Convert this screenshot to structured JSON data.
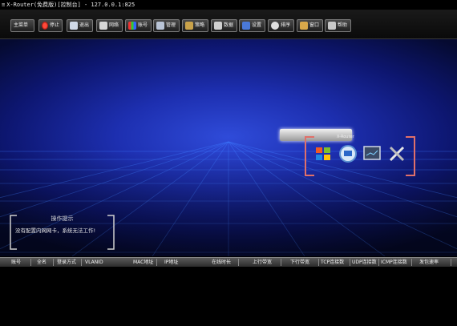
{
  "window": {
    "title": "X-Router(免费版)[控制台] - 127.0.0.1:825"
  },
  "toolbar": {
    "buttons": [
      {
        "label": "主菜单",
        "icon": "menu-icon"
      },
      {
        "label": "停止",
        "icon": "stop-icon"
      },
      {
        "label": "退出",
        "icon": "exit-icon"
      },
      {
        "label": "网络",
        "icon": "network-icon"
      },
      {
        "label": "账号",
        "icon": "account-icon"
      },
      {
        "label": "管理",
        "icon": "manage-icon"
      },
      {
        "label": "策略",
        "icon": "policy-icon"
      },
      {
        "label": "数据",
        "icon": "data-icon"
      },
      {
        "label": "设置",
        "icon": "settings-icon"
      },
      {
        "label": "排序",
        "icon": "sort-icon"
      },
      {
        "label": "窗口",
        "icon": "window-icon"
      },
      {
        "label": "帮助",
        "icon": "help-icon"
      }
    ]
  },
  "desktop": {
    "widget_label": "X-Router",
    "icons": [
      "windows-logo-icon",
      "gauge-icon",
      "monitor-icon",
      "tools-icon"
    ]
  },
  "hint": {
    "title": "操作提示",
    "message": "没有配置内网网卡，系统无法工作!"
  },
  "table": {
    "columns": [
      "账号",
      "全名",
      "登录方式",
      "VLANID",
      "MAC地址",
      "IP地址",
      "在线时长",
      "上行带宽",
      "下行带宽",
      "TCP连接数",
      "UDP连接数",
      "ICMP连接数",
      "发包速率"
    ]
  },
  "colors": {
    "stage_center": "#2f4bd9",
    "stage_edge": "#050a30",
    "grid_line": "#3f7bff",
    "frame_orange": "#e0706a"
  }
}
